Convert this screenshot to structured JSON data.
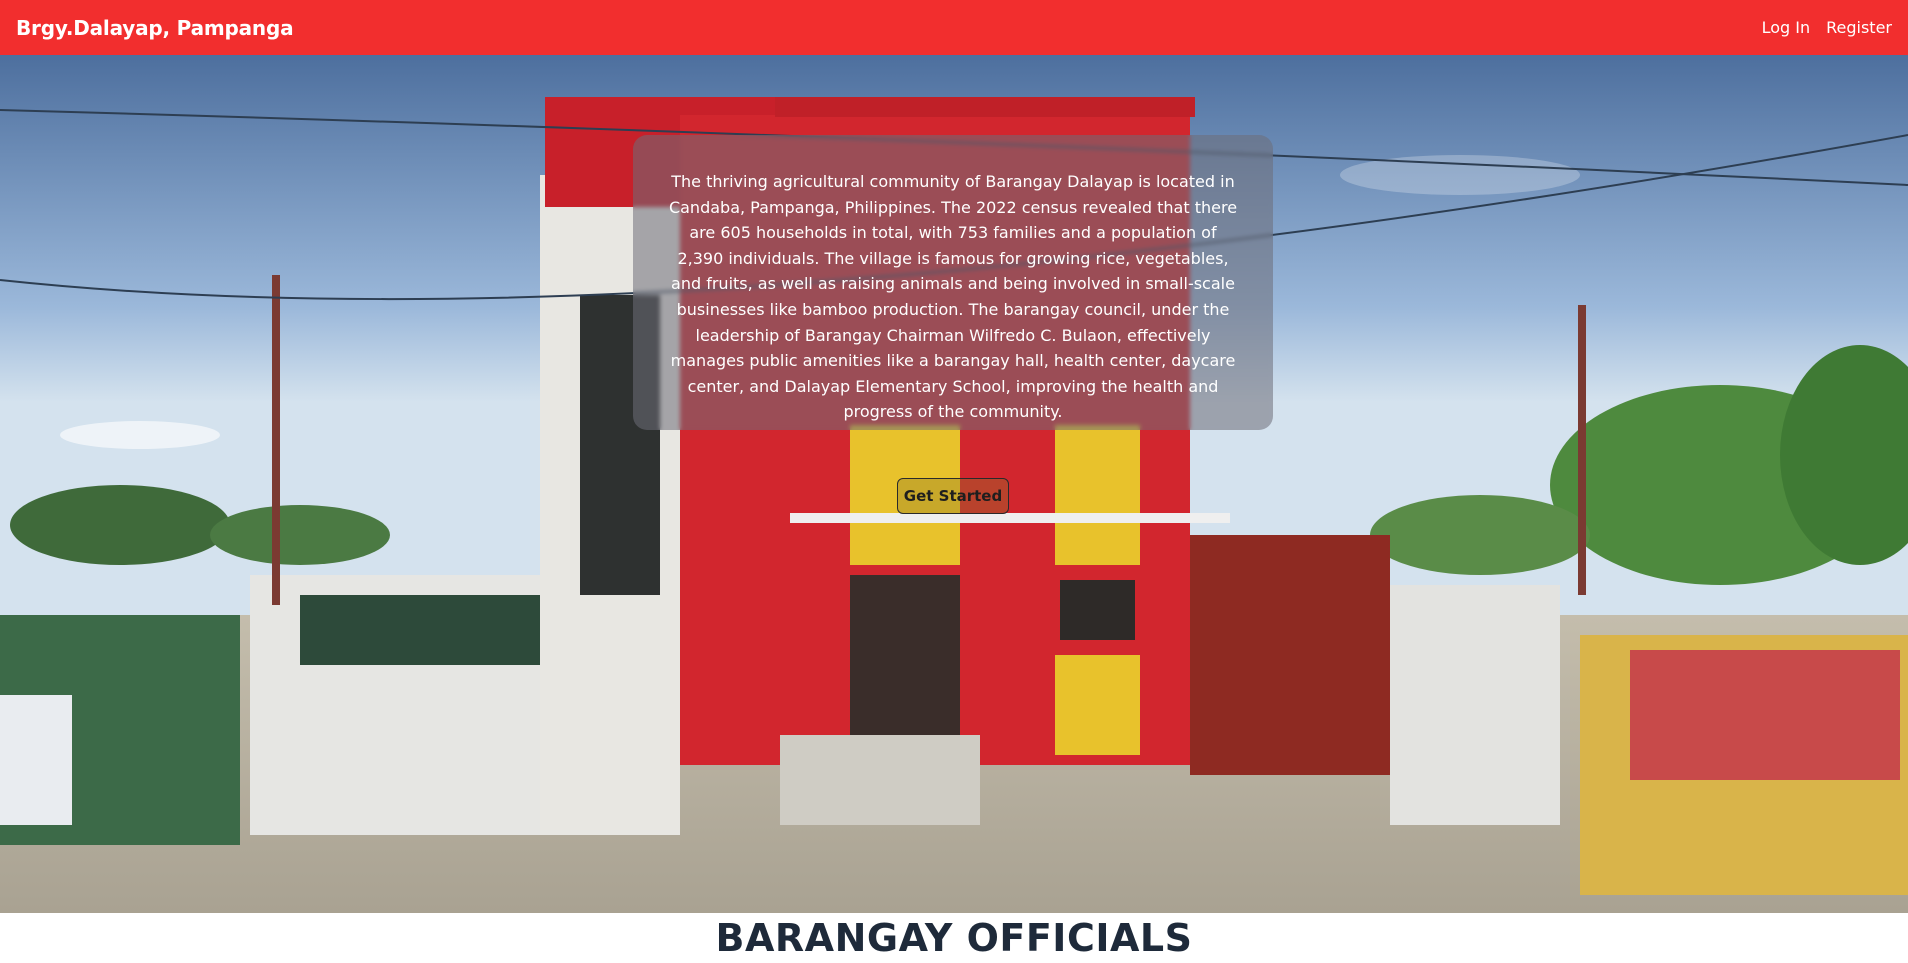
{
  "navbar": {
    "brand": "Brgy.Dalayap, Pampanga",
    "links": [
      "Log In",
      "Register"
    ],
    "background_color": "#f22e2e"
  },
  "hero": {
    "description": "The thriving agricultural community of Barangay Dalayap is located in Candaba, Pampanga, Philippines. The 2022 census revealed that there are 605 households in total, with 753 families and a population of 2,390 individuals. The village is famous for growing rice, vegetables, and fruits, as well as raising animals and being involved in small-scale businesses like bamboo production. The barangay council, under the leadership of Barangay Chairman Wilfredo C. Bulaon, effectively manages public amenities like a barangay hall, health center, daycare center, and Dalayap Elementary School, improving the health and progress of the community.",
    "cta_label": "Get Started",
    "background_image": "barangay-hall-photo"
  },
  "officials": {
    "heading": "BARANGAY OFFICIALS"
  }
}
